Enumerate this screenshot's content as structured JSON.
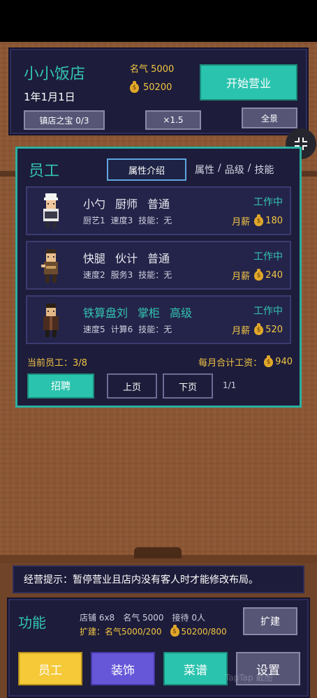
{
  "shop": {
    "name": "小小饭店",
    "date": "1年1月1日",
    "fame_label": "名气",
    "fame_value": "5000",
    "money": "50200",
    "start_button": "开始营业",
    "treasure_button": "镇店之宝 0/3",
    "speed_button": "×1.5",
    "panorama_button": "全景"
  },
  "staff": {
    "title": "员工",
    "attr_button": "属性介绍",
    "attr_tabs": [
      "属性",
      "/",
      "品级",
      "/",
      "技能"
    ],
    "members": [
      {
        "name": "小勺",
        "role": "厨师",
        "grade": "普通",
        "stats": [
          "厨艺1",
          "速度3",
          "技能：无"
        ],
        "status": "工作中",
        "salary_label": "月薪",
        "salary": "180"
      },
      {
        "name": "快腿",
        "role": "伙计",
        "grade": "普通",
        "stats": [
          "速度2",
          "服务3",
          "技能：无"
        ],
        "status": "工作中",
        "salary_label": "月薪",
        "salary": "240"
      },
      {
        "name": "铁算盘刘",
        "role": "掌柜",
        "grade": "高级",
        "stats": [
          "速度5",
          "计算6",
          "技能：无"
        ],
        "status": "工作中",
        "salary_label": "月薪",
        "salary": "520"
      }
    ],
    "current_label": "当前员工：3/8",
    "total_wage_label": "每月合计工资：",
    "total_wage": "940",
    "hire_button": "招聘",
    "prev_button": "上页",
    "next_button": "下页",
    "page_indicator": "1/1"
  },
  "tip": {
    "text": "经营提示：暂停营业且店内没有客人时才能修改布局。"
  },
  "functions": {
    "title": "功能",
    "info_line1": [
      "店铺 6x8",
      "名气 5000",
      "接待 0人"
    ],
    "expand_label": "扩建：名气5000/200",
    "expand_money": "50200/800",
    "expand_button": "扩建",
    "tabs": [
      "员工",
      "装饰",
      "菜谱",
      "设置"
    ]
  },
  "watermark": "TapTap 截图",
  "colors": {
    "accent_teal": "#2ac3ae",
    "gold": "#f2c644",
    "panel_bg": "#1d1c3a",
    "tab_yellow": "#f5c938",
    "tab_purple": "#6657d8"
  }
}
